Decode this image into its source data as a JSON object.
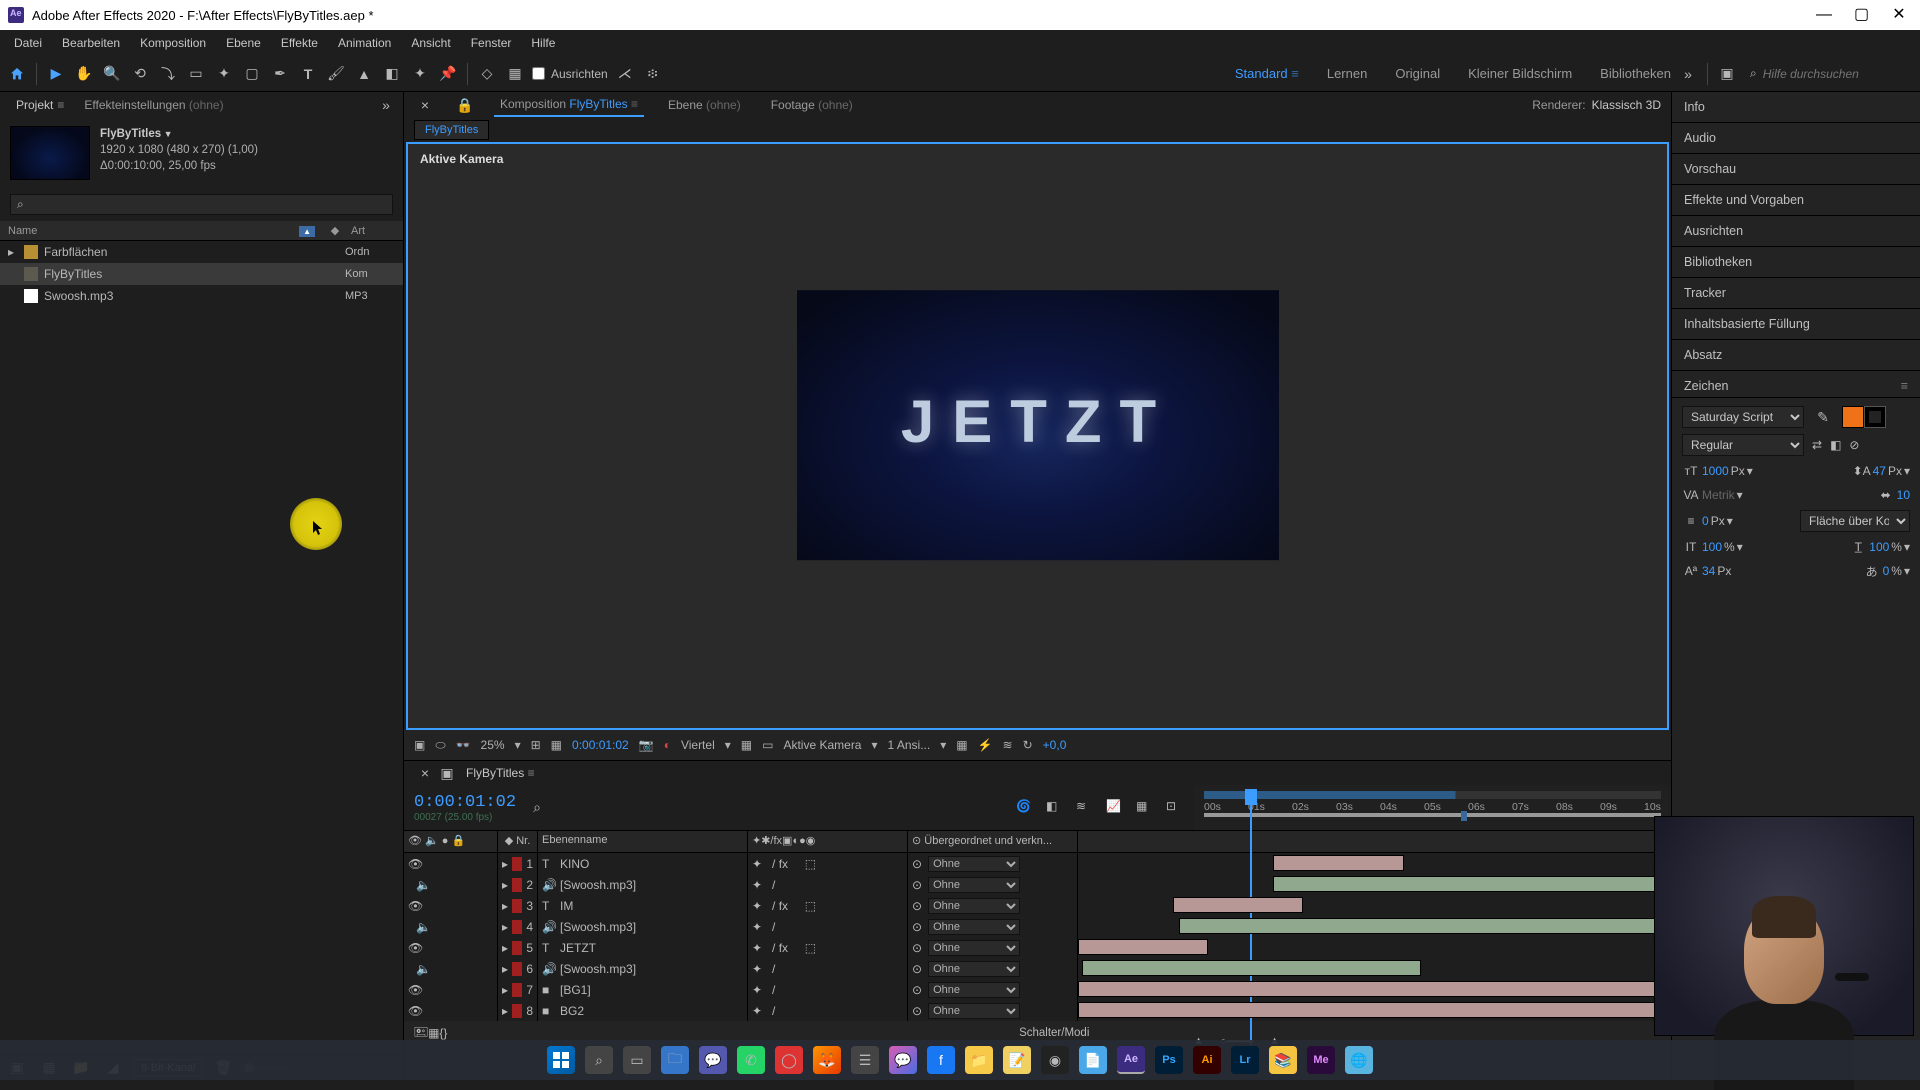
{
  "window": {
    "title": "Adobe After Effects 2020 - F:\\After Effects\\FlyByTitles.aep *"
  },
  "menu": [
    "Datei",
    "Bearbeiten",
    "Komposition",
    "Ebene",
    "Effekte",
    "Animation",
    "Ansicht",
    "Fenster",
    "Hilfe"
  ],
  "toolbar": {
    "ausrichten_label": "Ausrichten",
    "search_placeholder": "Hilfe durchsuchen"
  },
  "workspaces": {
    "items": [
      "Standard",
      "Lernen",
      "Original",
      "Kleiner Bildschirm",
      "Bibliotheken"
    ],
    "active": "Standard"
  },
  "project_panel": {
    "tabs": {
      "project": "Projekt",
      "effects": "Effekteinstellungen",
      "effects_suffix": "(ohne)"
    },
    "comp": {
      "name": "FlyByTitles",
      "dims": "1920 x 1080 (480 x 270) (1,00)",
      "time": "Δ0:00:10:00, 25,00 fps"
    },
    "columns": {
      "name": "Name",
      "tag": "◆",
      "type": "Art"
    },
    "items": [
      {
        "name": "Farbflächen",
        "type": "Ordn",
        "kind": "folder"
      },
      {
        "name": "FlyByTitles",
        "type": "Kom",
        "kind": "comp",
        "selected": true
      },
      {
        "name": "Swoosh.mp3",
        "type": "MP3",
        "kind": "audio"
      }
    ],
    "footer": {
      "bit": "8-Bit-Kanal"
    }
  },
  "viewer": {
    "comp_tab_prefix": "Komposition",
    "comp_name": "FlyByTitles",
    "layer_tab": "Ebene",
    "layer_suffix": "(ohne)",
    "footage_tab": "Footage",
    "footage_suffix": "(ohne)",
    "renderer_label": "Renderer:",
    "renderer_value": "Klassisch 3D",
    "flow_tab": "FlyByTitles",
    "active_camera": "Aktive Kamera",
    "preview_text": "JETZT",
    "controls": {
      "zoom": "25%",
      "timecode": "0:00:01:02",
      "res": "Viertel",
      "cam": "Aktive Kamera",
      "views": "1 Ansi...",
      "exposure": "+0,0"
    }
  },
  "right_panels": [
    "Info",
    "Audio",
    "Vorschau",
    "Effekte und Vorgaben",
    "Ausrichten",
    "Bibliotheken",
    "Tracker",
    "Inhaltsbasierte Füllung",
    "Absatz",
    "Zeichen"
  ],
  "char_panel": {
    "font": "Saturday Script",
    "style": "Regular",
    "size": "1000",
    "size_unit": "Px",
    "leading": "47",
    "leading_unit": "Px",
    "kerning": "Metrik",
    "tracking": "10",
    "stroke_w": "0",
    "stroke_w_unit": "Px",
    "stroke_mode": "Fläche über Kon...",
    "vscale": "100",
    "vscale_unit": "%",
    "hscale": "100",
    "hscale_unit": "%",
    "baseline": "34",
    "baseline_unit": "Px",
    "tsume": "0",
    "tsume_unit": "%",
    "fill_color": "#f07218"
  },
  "timeline": {
    "tab": "FlyByTitles",
    "timecode": "0:00:01:02",
    "subtc": "00027 (25.00 fps)",
    "ruler": [
      "00s",
      "01s",
      "02s",
      "03s",
      "04s",
      "05s",
      "06s",
      "07s",
      "08s",
      "09s",
      "10s"
    ],
    "columns": {
      "eye": "",
      "nr": "Nr.",
      "src": "Ebenenname",
      "parent": "Übergeordnet und verkn..."
    },
    "parent_option": "Ohne",
    "switch_label": "Schalter/Modi",
    "layers": [
      {
        "nr": "1",
        "name": "KINO",
        "kind": "T",
        "video": true,
        "audio": false,
        "has3d": true,
        "start": 33,
        "end": 55,
        "type": "video"
      },
      {
        "nr": "2",
        "name": "[Swoosh.mp3]",
        "kind": "A",
        "video": false,
        "audio": true,
        "has3d": false,
        "start": 33,
        "end": 100,
        "type": "audio"
      },
      {
        "nr": "3",
        "name": "IM",
        "kind": "T",
        "video": true,
        "audio": false,
        "has3d": true,
        "start": 16,
        "end": 38,
        "type": "video"
      },
      {
        "nr": "4",
        "name": "[Swoosh.mp3]",
        "kind": "A",
        "video": false,
        "audio": true,
        "has3d": false,
        "start": 17,
        "end": 100,
        "type": "audio"
      },
      {
        "nr": "5",
        "name": "JETZT",
        "kind": "T",
        "video": true,
        "audio": false,
        "has3d": true,
        "start": 0,
        "end": 22,
        "type": "video"
      },
      {
        "nr": "6",
        "name": "[Swoosh.mp3]",
        "kind": "A",
        "video": false,
        "audio": true,
        "has3d": false,
        "start": 0.6,
        "end": 58,
        "type": "audio"
      },
      {
        "nr": "7",
        "name": "[BG1]",
        "kind": "S",
        "video": true,
        "audio": false,
        "has3d": false,
        "start": 0,
        "end": 100,
        "type": "video"
      },
      {
        "nr": "8",
        "name": "BG2",
        "kind": "S",
        "video": true,
        "audio": false,
        "has3d": false,
        "start": 0,
        "end": 100,
        "type": "video"
      }
    ]
  }
}
